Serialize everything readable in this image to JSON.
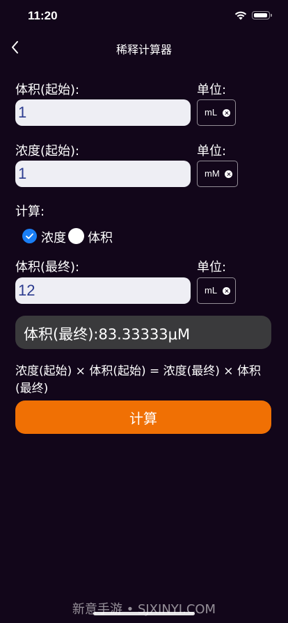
{
  "status_bar": {
    "time": "11:20"
  },
  "nav": {
    "title": "稀释计算器"
  },
  "initial_volume": {
    "label": "体积(起始):",
    "value": "1",
    "unit_label": "单位:",
    "unit": "mL"
  },
  "initial_concentration": {
    "label": "浓度(起始):",
    "value": "1",
    "unit_label": "单位:",
    "unit": "mM"
  },
  "calculate": {
    "label": "计算:",
    "options": [
      {
        "label": "浓度",
        "checked": true
      },
      {
        "label": "体积",
        "checked": false
      }
    ]
  },
  "final_volume": {
    "label": "体积(最终):",
    "value": "12",
    "unit_label": "单位:",
    "unit": "mL"
  },
  "result": {
    "text": "体积(最终):83.33333μM"
  },
  "formula": "浓度(起始) × 体积(起始) = 浓度(最终) × 体积(最终)",
  "button": {
    "label": "计算"
  },
  "watermark": "新意手游 • SJXINYI.COM",
  "colors": {
    "background": "#12061a",
    "accent": "#f07004",
    "radio_checked": "#1a7ef5",
    "result_bg": "#3a3a3c",
    "input_bg": "#eeeef4",
    "input_text": "#2b3b8f"
  }
}
